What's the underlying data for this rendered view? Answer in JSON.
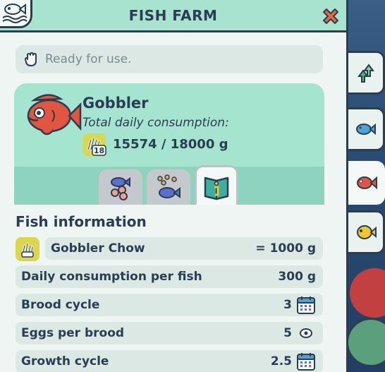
{
  "title": "FISH FARM",
  "status": {
    "text": "Ready for use."
  },
  "fish": {
    "name": "Gobbler",
    "consumption_label": "Total daily consumption:",
    "food_badge": "18",
    "amount": "15574 / 18000 g"
  },
  "tabs": [
    {
      "name": "breeding",
      "active": false
    },
    {
      "name": "feeding",
      "active": false
    },
    {
      "name": "info",
      "active": true
    }
  ],
  "section_title": "Fish information",
  "info": {
    "chow_label": "Gobbler Chow",
    "chow_value": "= 1000 g",
    "daily_label": "Daily consumption per fish",
    "daily_value": "300 g",
    "brood_label": "Brood cycle",
    "brood_value": "3",
    "eggs_label": "Eggs per brood",
    "eggs_value": "5",
    "growth_label": "Growth cycle",
    "growth_value": "2.5"
  },
  "colors": {
    "title_bg": "#a7e3cf",
    "panel_bg": "#eef5f2",
    "card_bg": "#a5e4cf",
    "row_bg": "#dce8e4",
    "text": "#2b3d52",
    "close": "#e86a3a",
    "fish": "#e2563f"
  },
  "side_tabs": [
    "upgrade-arrows-icon",
    "blue-fish-icon",
    "red-fish-icon",
    "yellow-fish-icon"
  ]
}
